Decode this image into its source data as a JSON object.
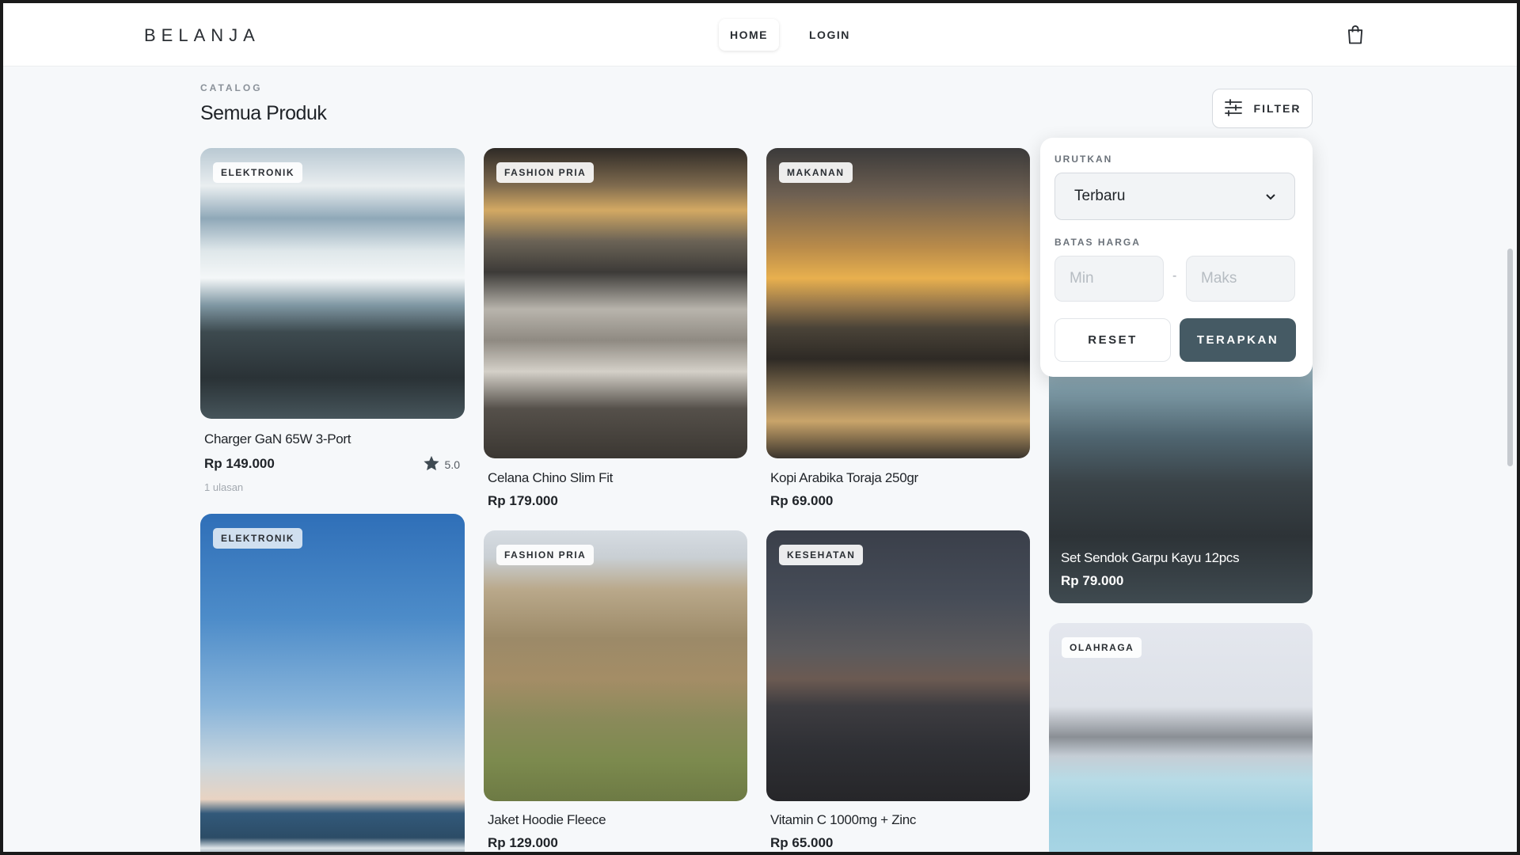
{
  "header": {
    "brand": "BELANJA",
    "nav": [
      {
        "label": "HOME",
        "active": true
      },
      {
        "label": "LOGIN",
        "active": false
      }
    ],
    "cart_icon": "shopping-bag-icon"
  },
  "catalog": {
    "eyebrow": "CATALOG",
    "title": "Semua Produk",
    "filter_label": "FILTER",
    "filter_icon": "sliders-icon"
  },
  "filter_panel": {
    "sort_label": "URUTKAN",
    "sort_value": "Terbaru",
    "price_label": "BATAS HARGA",
    "min_placeholder": "Min",
    "max_placeholder": "Maks",
    "dash": "-",
    "reset_label": "RESET",
    "apply_label": "TERAPKAN"
  },
  "products": [
    {
      "category": "ELEKTRONIK",
      "name": "Charger GaN 65W 3-Port",
      "price": "Rp 149.000",
      "rating": "5.0",
      "reviews": "1 ulasan"
    },
    {
      "category": "FASHION PRIA",
      "name": "Celana Chino Slim Fit",
      "price": "Rp 179.000"
    },
    {
      "category": "MAKANAN",
      "name": "Kopi Arabika Toraja 250gr",
      "price": "Rp 69.000"
    },
    {
      "name": "Set Sendok Garpu Kayu 12pcs",
      "price": "Rp 79.000"
    },
    {
      "category": "ELEKTRONIK"
    },
    {
      "category": "FASHION PRIA",
      "name": "Jaket Hoodie Fleece",
      "price": "Rp 129.000"
    },
    {
      "category": "KESEHATAN",
      "name": "Vitamin C 1000mg + Zinc",
      "price": "Rp 65.000"
    },
    {
      "category": "OLAHRAGA"
    }
  ],
  "colors": {
    "accent": "#455a64",
    "background": "#f6f8fa",
    "star": "#3f4a52"
  }
}
